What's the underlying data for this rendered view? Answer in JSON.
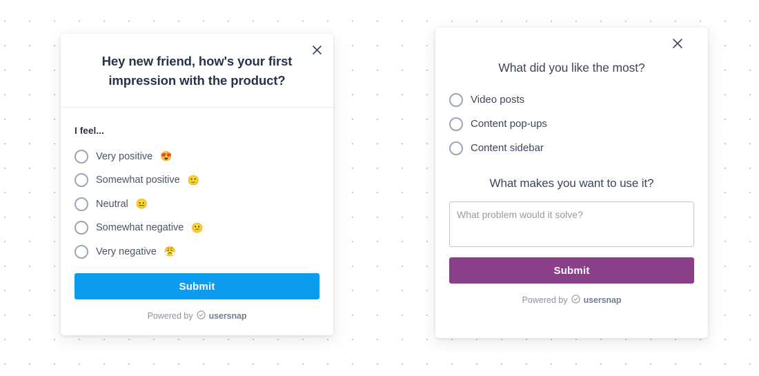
{
  "background": {
    "dot_color": "#b9bcc4",
    "page_color": "#ffffff"
  },
  "cards": {
    "left": {
      "name": "first-impression-survey",
      "close_icon": "close-icon",
      "title": "Hey new friend, how's your first impression with the product?",
      "field_label": "I feel...",
      "options": [
        {
          "label": "Very positive",
          "emoji": "😍"
        },
        {
          "label": "Somewhat positive",
          "emoji": "🙂"
        },
        {
          "label": "Neutral",
          "emoji": "😐"
        },
        {
          "label": "Somewhat negative",
          "emoji": "😕"
        },
        {
          "label": "Very negative",
          "emoji": "😤"
        }
      ],
      "submit_label": "Submit",
      "submit_color": "#0d9bf0",
      "footer": {
        "powered_by": "Powered by",
        "brand": "usersnap",
        "logo_icon": "check-circle-icon"
      }
    },
    "right": {
      "name": "feature-preference-survey",
      "close_icon": "close-icon",
      "title": "What did you like the most?",
      "options": [
        {
          "label": "Video posts"
        },
        {
          "label": "Content pop-ups"
        },
        {
          "label": "Content sidebar"
        }
      ],
      "sub_title": "What makes you want to use it?",
      "textarea_placeholder": "What problem would it solve?",
      "textarea_value": "",
      "submit_label": "Submit",
      "submit_color": "#8a3f89",
      "footer": {
        "powered_by": "Powered by",
        "brand": "usersnap",
        "logo_icon": "check-circle-icon"
      }
    }
  }
}
